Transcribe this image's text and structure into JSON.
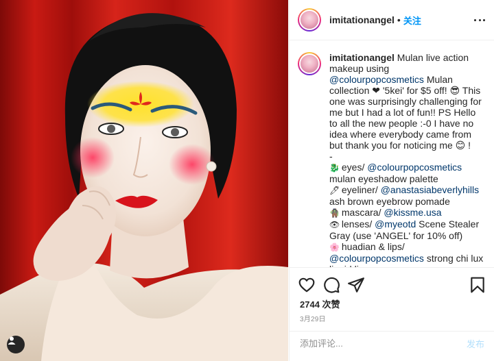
{
  "photo": {
    "alt": "imitationangel Mulan makeup photo"
  },
  "header": {
    "username": "imitationangel",
    "separator": "•",
    "follow_label": "关注"
  },
  "caption": {
    "username": "imitationangel",
    "line1": " Mulan live action makeup using ",
    "mention1": "@colourpopcosmetics",
    "line2": " Mulan collection ❤ '5kei' for $5 off! 😎 This one was surprisingly challenging for me but I had a lot of fun!! PS Hello to all the new people :-0 I have no idea where everybody came from but thank you for noticing me 😊 !",
    "dash": "-",
    "items": [
      {
        "emoji": "🐉",
        "pre": " eyes/ ",
        "mention": "@colourpopcosmetics",
        "post": " mulan eyeshadow palette"
      },
      {
        "emoji": "🖊",
        "pre": " eyeliner/ ",
        "mention": "@anastasiabeverlyhills",
        "post": " ash brown eyebrow pomade"
      },
      {
        "emoji": "🧌",
        "pre": " mascara/ ",
        "mention": "@kissme.usa",
        "post": ""
      },
      {
        "emoji": "👁",
        "pre": " lenses/ ",
        "mention": "@myeotd",
        "post": " Scene Stealer Gray (use 'ANGEL' for 10% off)"
      },
      {
        "emoji": "🌸",
        "pre": " huadian & lips/ ",
        "mention": "",
        "post": ""
      },
      {
        "emoji": "",
        "pre": "",
        "mention": "@colourpopcosmetics",
        "post": " strong chi lux liquid lip"
      }
    ]
  },
  "actions": {
    "likes": "2744 次赞",
    "date": "3月29日",
    "comment_placeholder": "添加评论...",
    "post_label": "发布"
  }
}
